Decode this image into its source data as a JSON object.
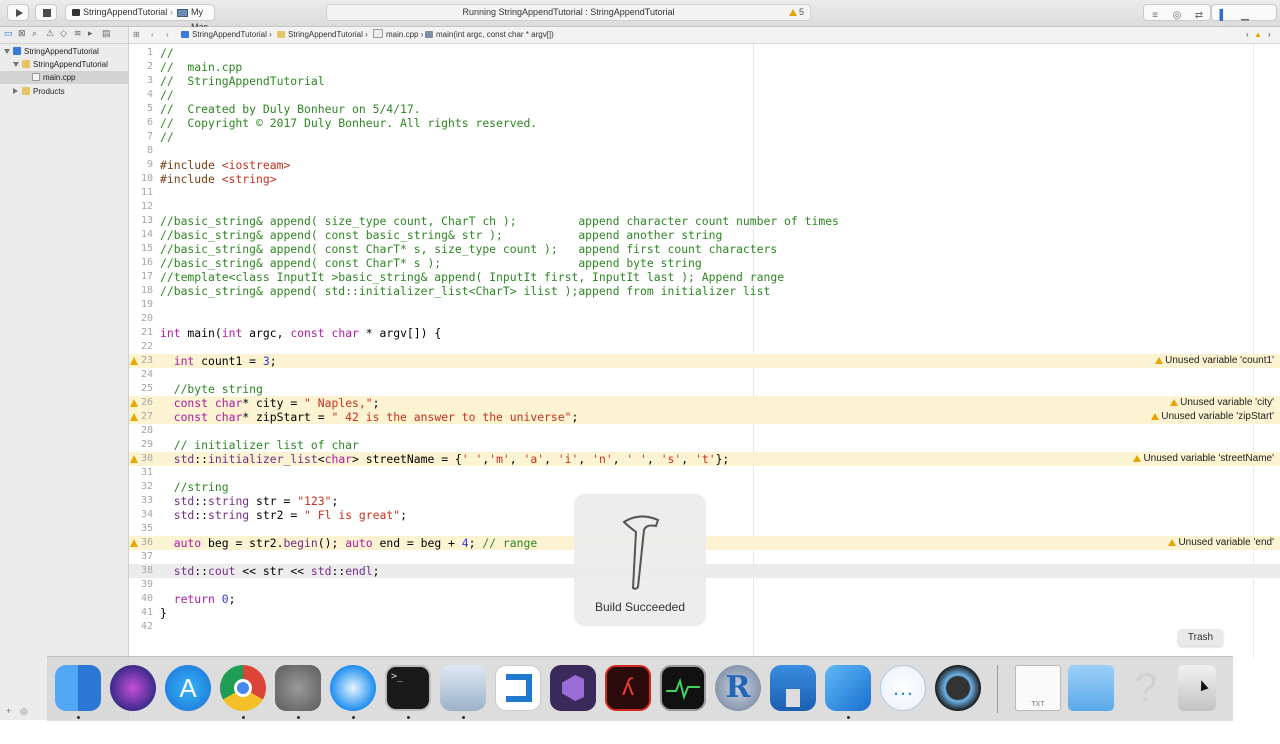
{
  "toolbar": {
    "scheme_target": "StringAppendTutorial",
    "scheme_separator": "›",
    "scheme_device": "My Mac",
    "activity_text": "Running StringAppendTutorial : StringAppendTutorial",
    "warning_count": "5"
  },
  "navigator": {
    "items": [
      {
        "label": "StringAppendTutorial",
        "kind": "project"
      },
      {
        "label": "StringAppendTutorial",
        "kind": "folder"
      },
      {
        "label": "main.cpp",
        "kind": "file"
      },
      {
        "label": "Products",
        "kind": "folder"
      }
    ]
  },
  "jumpbar": {
    "crumbs": [
      "StringAppendTutorial",
      "StringAppendTutorial",
      "main.cpp",
      "main(int argc, const char * argv[])"
    ]
  },
  "editor": {
    "lines": [
      {
        "n": "1",
        "code": "//"
      },
      {
        "n": "2",
        "code": "//  main.cpp"
      },
      {
        "n": "3",
        "code": "//  StringAppendTutorial"
      },
      {
        "n": "4",
        "code": "//"
      },
      {
        "n": "5",
        "code": "//  Created by Duly Bonheur on 5/4/17."
      },
      {
        "n": "6",
        "code": "//  Copyright © 2017 Duly Bonheur. All rights reserved."
      },
      {
        "n": "7",
        "code": "//"
      },
      {
        "n": "8",
        "code": ""
      },
      {
        "n": "9",
        "code": "#include <iostream>"
      },
      {
        "n": "10",
        "code": "#include <string>"
      },
      {
        "n": "11",
        "code": ""
      },
      {
        "n": "12",
        "code": ""
      },
      {
        "n": "13",
        "code": "//basic_string& append( size_type count, CharT ch );         append character count number of times"
      },
      {
        "n": "14",
        "code": "//basic_string& append( const basic_string& str );           append another string"
      },
      {
        "n": "15",
        "code": "//basic_string& append( const CharT* s, size_type count );   append first count characters"
      },
      {
        "n": "16",
        "code": "//basic_string& append( const CharT* s );                    append byte string"
      },
      {
        "n": "17",
        "code": "//template<class InputIt >basic_string& append( InputIt first, InputIt last ); Append range"
      },
      {
        "n": "18",
        "code": "//basic_string& append( std::initializer_list<CharT> ilist );append from initializer list"
      },
      {
        "n": "19",
        "code": ""
      },
      {
        "n": "20",
        "code": ""
      },
      {
        "n": "21",
        "code": "int main(int argc, const char * argv[]) {"
      },
      {
        "n": "22",
        "code": ""
      },
      {
        "n": "23",
        "code": "  int count1 = 3;"
      },
      {
        "n": "24",
        "code": ""
      },
      {
        "n": "25",
        "code": "  //byte string"
      },
      {
        "n": "26",
        "code": "  const char* city = \" Naples,\";"
      },
      {
        "n": "27",
        "code": "  const char* zipStart = \" 42 is the answer to the universe\";"
      },
      {
        "n": "28",
        "code": ""
      },
      {
        "n": "29",
        "code": "  // initializer list of char"
      },
      {
        "n": "30",
        "code": "  std::initializer_list<char> streetName = {' ','m', 'a', 'i', 'n', ' ', 's', 't'};"
      },
      {
        "n": "31",
        "code": ""
      },
      {
        "n": "32",
        "code": "  //string"
      },
      {
        "n": "33",
        "code": "  std::string str = \"123\";"
      },
      {
        "n": "34",
        "code": "  std::string str2 = \" Fl is great\";"
      },
      {
        "n": "35",
        "code": ""
      },
      {
        "n": "36",
        "code": "  auto beg = str2.begin(); auto end = beg + 4; // range"
      },
      {
        "n": "37",
        "code": ""
      },
      {
        "n": "38",
        "code": "  std::cout << str << std::endl;"
      },
      {
        "n": "39",
        "code": ""
      },
      {
        "n": "40",
        "code": "  return 0;"
      },
      {
        "n": "41",
        "code": "}"
      },
      {
        "n": "42",
        "code": ""
      }
    ],
    "warnings": [
      {
        "line": "23",
        "message": "Unused variable 'count1'"
      },
      {
        "line": "26",
        "message": "Unused variable 'city'"
      },
      {
        "line": "27",
        "message": "Unused variable 'zipStart'"
      },
      {
        "line": "30",
        "message": "Unused variable 'streetName'"
      },
      {
        "line": "36",
        "message": "Unused variable 'end'"
      }
    ],
    "current_line": "38"
  },
  "hud": {
    "label": "Build Succeeded",
    "icon": "hammer-icon"
  },
  "dock": {
    "tooltip": "Trash",
    "items": [
      "Finder",
      "Siri",
      "App Store",
      "Chrome",
      "System Preferences",
      "Safari",
      "Terminal",
      "Preview",
      "Visual Studio Code",
      "Visual Studio",
      "Acrobat",
      "Activity Monitor",
      "R",
      "Keynote",
      "Xcode",
      "Messages",
      "QuickTime Player",
      "TXT",
      "Folder",
      "Help",
      "Trash"
    ],
    "colors": {
      "finder": "#3b8fe0",
      "chrome": "#dc4437",
      "safari": "#1c8ef0",
      "vscode": "#1f7acd",
      "acrobat": "#d22a1e",
      "r": "#2266b8",
      "xcode": "#1b8ce6"
    }
  }
}
